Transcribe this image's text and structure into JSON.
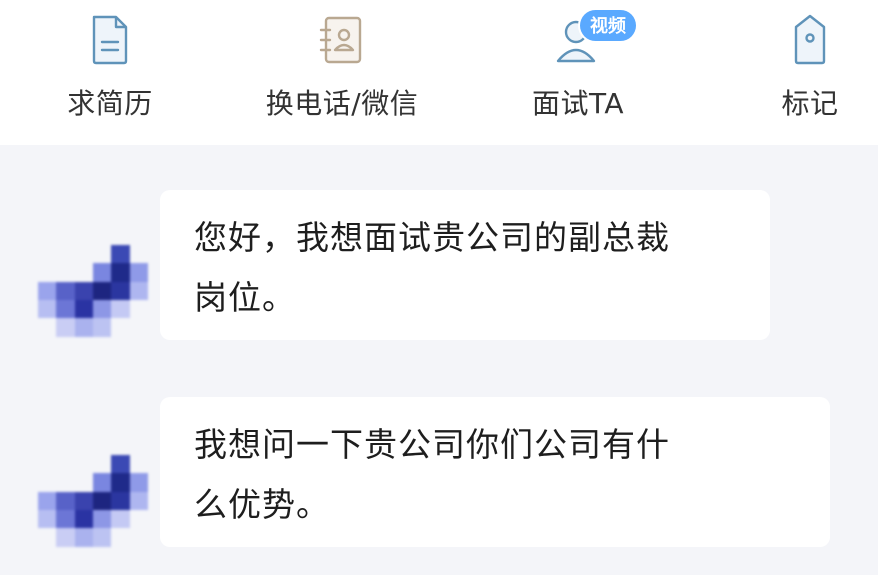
{
  "toolbar": {
    "items": [
      {
        "label": "求简历",
        "icon": "resume-icon"
      },
      {
        "label": "换电话/微信",
        "icon": "contact-card-icon"
      },
      {
        "label": "面试TA",
        "icon": "person-icon",
        "badge": "视频"
      },
      {
        "label": "标记",
        "icon": "tag-icon"
      }
    ]
  },
  "messages": [
    {
      "line1": "您好，我想面试贵公司的副总裁",
      "line2": "岗位。"
    },
    {
      "line1": "我想问一下贵公司你们公司有什",
      "line2": "么优势。"
    }
  ],
  "colors": {
    "icon": "#5f93b9",
    "badge": "#5aa9ff",
    "chat_bg": "#f4f5f9",
    "bubble_bg": "#ffffff"
  }
}
